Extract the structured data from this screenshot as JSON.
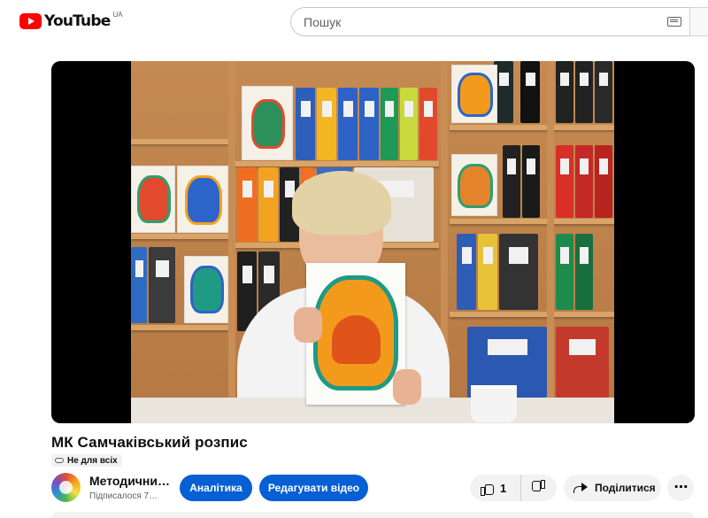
{
  "header": {
    "logo_text": "YouTube",
    "country_code": "UA",
    "search_placeholder": "Пошук",
    "brand_color": "#ff0000"
  },
  "video": {
    "title": "МК Самчаківський розпис",
    "visibility_badge": "Не для всіх"
  },
  "channel": {
    "name": "Методични…",
    "subscribers": "Підписалося 7…"
  },
  "actions": {
    "analytics_label": "Аналітика",
    "edit_label": "Редагувати відео",
    "like_count": "1",
    "share_label": "Поділитися",
    "more_label": "⋯",
    "accent_color": "#065fd4"
  },
  "icons": [
    "youtube-logo-icon",
    "keyboard-icon",
    "link-icon",
    "thumbs-up-icon",
    "thumbs-down-icon",
    "share-icon",
    "more-icon"
  ]
}
